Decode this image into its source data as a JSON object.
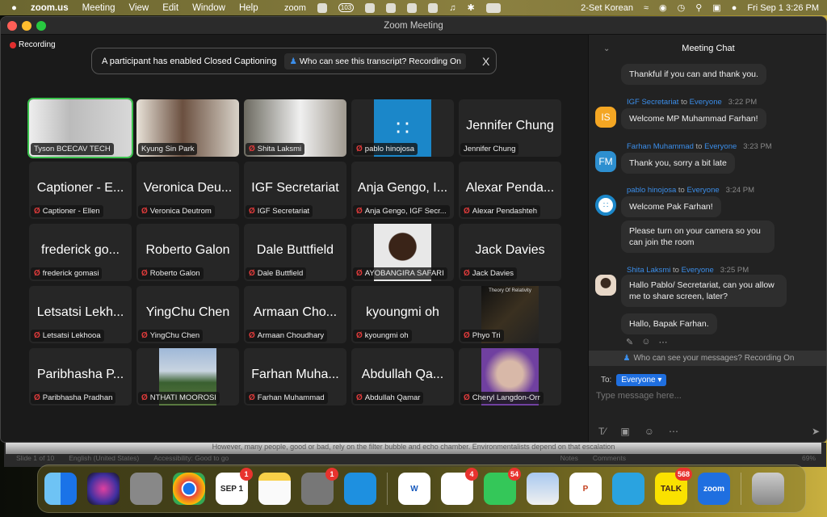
{
  "menubar": {
    "app": "zoom.us",
    "items": [
      "Meeting",
      "View",
      "Edit",
      "Window",
      "Help"
    ],
    "zoom_label": "zoom",
    "status_badge": "103",
    "input_source": "2-Set Korean",
    "clock": "Fri Sep 1  3:26 PM"
  },
  "window": {
    "title": "Zoom Meeting"
  },
  "recording": {
    "label": "Recording",
    "color": "#e02e2e"
  },
  "cc_banner": {
    "text": "A participant has enabled Closed Captioning",
    "who_button": "Who can see this transcript? Recording On",
    "close": "X"
  },
  "tiles": [
    {
      "big": "",
      "label": "Tyson BCECAV TECH",
      "muted": false,
      "kind": "video",
      "active": true,
      "bg": "linear-gradient(90deg,#eee,#bbb 40%,#d8d8d8)"
    },
    {
      "big": "",
      "label": "Kyung Sin Park",
      "muted": false,
      "kind": "video",
      "bg": "linear-gradient(90deg,#e8e2d8,#6b5040 45%,#d8d2c8)"
    },
    {
      "big": "",
      "label": "Shita Laksmi",
      "muted": true,
      "kind": "video",
      "bg": "linear-gradient(90deg,#6c6a60,#f0f0f0 55%,#a09a90)"
    },
    {
      "big": "",
      "label": "pablo hinojosa",
      "muted": true,
      "kind": "logo",
      "bg": "#1b87c9"
    },
    {
      "big": "Jennifer Chung",
      "label": "Jennifer Chung",
      "muted": false,
      "kind": "text"
    },
    {
      "big": "Captioner - E...",
      "label": "Captioner - Ellen",
      "muted": true,
      "kind": "text"
    },
    {
      "big": "Veronica Deu...",
      "label": "Veronica Deutrom",
      "muted": true,
      "kind": "text"
    },
    {
      "big": "IGF Secretariat",
      "label": "IGF Secretariat",
      "muted": true,
      "kind": "text"
    },
    {
      "big": "Anja Gengo, I...",
      "label": "Anja Gengo, IGF Secr...",
      "muted": true,
      "kind": "text"
    },
    {
      "big": "Alexar Penda...",
      "label": "Alexar Pendashteh",
      "muted": true,
      "kind": "text"
    },
    {
      "big": "frederick go...",
      "label": "frederick gomasi",
      "muted": true,
      "kind": "text"
    },
    {
      "big": "Roberto Galon",
      "label": "Roberto Galon",
      "muted": true,
      "kind": "text"
    },
    {
      "big": "Dale Buttfield",
      "label": "Dale Buttfield",
      "muted": true,
      "kind": "text"
    },
    {
      "big": "",
      "label": "AYOBANGIRA SAFARI",
      "muted": true,
      "kind": "photo",
      "bg": "radial-gradient(circle at 50% 40%,#3a2418 30%,#e8e8e8 32%)"
    },
    {
      "big": "Jack Davies",
      "label": "Jack Davies",
      "muted": true,
      "kind": "text"
    },
    {
      "big": "Letsatsi Lekh...",
      "label": "Letsatsi Lekhooa",
      "muted": true,
      "kind": "text"
    },
    {
      "big": "YingChu Chen",
      "label": "YingChu Chen",
      "muted": true,
      "kind": "text"
    },
    {
      "big": "Armaan Cho...",
      "label": "Armaan Choudhary",
      "muted": true,
      "kind": "text"
    },
    {
      "big": "kyoungmi oh",
      "label": "kyoungmi oh",
      "muted": true,
      "kind": "text"
    },
    {
      "big": "",
      "label": "Phyo Tri",
      "muted": true,
      "kind": "photo",
      "caption": "Theory Of Relativity",
      "bg": "linear-gradient(135deg,#111,#3a3020 50%,#222)"
    },
    {
      "big": "Paribhasha P...",
      "label": "Paribhasha Pradhan",
      "muted": true,
      "kind": "text"
    },
    {
      "big": "",
      "label": "NTHATI MOOROSI",
      "muted": true,
      "kind": "photo",
      "bg": "linear-gradient(#9fb8d8,#c8d4e0 40%,#3a6030 60%,#5a7a40)"
    },
    {
      "big": "Farhan Muha...",
      "label": "Farhan Muhammad",
      "muted": true,
      "kind": "text"
    },
    {
      "big": "Abdullah Qa...",
      "label": "Abdullah Qamar",
      "muted": true,
      "kind": "text"
    },
    {
      "big": "",
      "label": "Cheryl Langdon-Orr",
      "muted": true,
      "kind": "photo",
      "bg": "radial-gradient(circle at 50% 45%,#d8b8a8 30%,#7040a0 60%)"
    }
  ],
  "chat": {
    "title": "Meeting Chat",
    "messages": [
      {
        "text": "Thankful if you can and thank you."
      },
      {
        "sender": "IGF Secretariat",
        "to": "to",
        "recipient": "Everyone",
        "time": "3:22 PM",
        "avatar": "IS",
        "avatar_color": "#f4a623",
        "text": "Welcome MP Muhammad Farhan!"
      },
      {
        "sender": "Farhan Muhammad",
        "to": "to",
        "recipient": "Everyone",
        "time": "3:23 PM",
        "avatar": "FM",
        "avatar_color": "#2d8fd0",
        "text": "Thank you, sorry a bit late"
      },
      {
        "sender": "pablo hinojosa",
        "to": "to",
        "recipient": "Everyone",
        "time": "3:24 PM",
        "avatar": "",
        "avatar_color": "#1b87c9",
        "text": "Welcome Pak Farhan!"
      },
      {
        "text": "Please turn on your camera so you can join the room"
      },
      {
        "sender": "Shita Laksmi",
        "to": "to",
        "recipient": "Everyone",
        "time": "3:25 PM",
        "avatar": "",
        "avatar_color": "#c8a890",
        "text": "Hallo Pablo/ Secretariat, can you allow me to share screen, later?"
      },
      {
        "text": "Hallo, Bapak Farhan."
      }
    ],
    "who_can_see": "Who can see your messages? Recording On",
    "to_label": "To:",
    "recipient": "Everyone",
    "placeholder": "Type message here..."
  },
  "behind_window": {
    "text": "However, many people, good or bad, rely on the filter bubble and echo chamber. Environmentalists depend on that escalation",
    "slide": "Slide 1 of 10",
    "language": "English (United States)",
    "accessibility": "Accessibility: Good to go",
    "notes": "Notes",
    "comments": "Comments",
    "zoom": "69%"
  },
  "dock": [
    {
      "name": "finder",
      "bg": "linear-gradient(90deg,#6ec3f5 50%,#1a73e8 50%)"
    },
    {
      "name": "siri",
      "bg": "radial-gradient(circle,#e040a0,#4030a0 60%,#111)"
    },
    {
      "name": "launchpad",
      "bg": "#888"
    },
    {
      "name": "chrome",
      "bg": "radial-gradient(circle,#1a73e8 25%,#fff 27%,#fff 32%,#e8453c 34%,#fbbc05 70%,#34a853 72%)"
    },
    {
      "name": "calendar",
      "bg": "#fff",
      "text": "SEP 1",
      "badge": "1",
      "color": "#222"
    },
    {
      "name": "notes",
      "bg": "linear-gradient(#f8d048 25%,#fafafa 25%)"
    },
    {
      "name": "system-settings",
      "bg": "#777",
      "badge": "1"
    },
    {
      "name": "app",
      "bg": "#1e90e0"
    },
    {
      "sep": true
    },
    {
      "name": "word",
      "bg": "#fff",
      "text": "W",
      "color": "#185abd"
    },
    {
      "name": "microsoft-store",
      "bg": "#fff",
      "badge": "4"
    },
    {
      "name": "messages",
      "bg": "#34c759",
      "badge": "54"
    },
    {
      "name": "preview",
      "bg": "linear-gradient(#a8c8f0,#f0f0f0)"
    },
    {
      "name": "powerpoint",
      "bg": "#fff",
      "text": "P",
      "color": "#c43e1c"
    },
    {
      "name": "telegram",
      "bg": "#2aa3e0"
    },
    {
      "name": "kakaotalk",
      "bg": "#fae100",
      "text": "TALK",
      "badge": "568",
      "color": "#3a1d1d"
    },
    {
      "name": "zoom",
      "bg": "#1f6fe0",
      "text": "zoom"
    },
    {
      "sep": true
    },
    {
      "name": "trash",
      "bg": "linear-gradient(#ccc,#888)"
    }
  ]
}
